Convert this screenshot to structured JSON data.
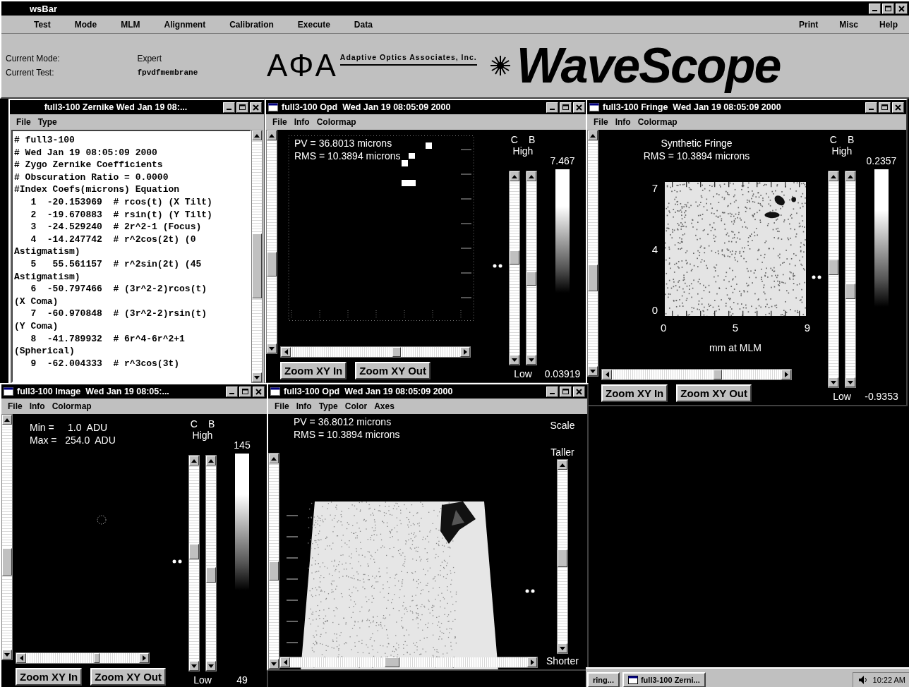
{
  "main_bar": {
    "title": "wsBar",
    "menu": [
      "Test",
      "Mode",
      "MLM",
      "Alignment",
      "Calibration",
      "Execute",
      "Data"
    ],
    "right_menu": [
      "Print",
      "Misc",
      "Help"
    ],
    "current_mode_label": "Current Mode:",
    "current_mode": "Expert",
    "current_test_label": "Current Test:",
    "current_test": "fpvdfmembrane",
    "logo": "AΦA",
    "company": "Adaptive Optics Associates, Inc.",
    "product": "WaveScope"
  },
  "windows": [
    {
      "kind": "text",
      "title": "full3-100 Zernike Wed Jan 19 08:...",
      "menu": [
        "File",
        "Type"
      ],
      "lines": [
        "# full3-100",
        "# Wed Jan 19 08:05:09 2000",
        "# Zygo Zernike Coefficients",
        "# Obscuration Ratio = 0.0000",
        "#Index Coefs(microns) Equation",
        "   1  -20.153969  # rcos(t) (X Tilt)",
        "   2  -19.670883  # rsin(t) (Y Tilt)",
        "   3  -24.529240  # 2r^2-1 (Focus)",
        "   4  -14.247742  # r^2cos(2t) (0",
        "Astigmatism)",
        "   5   55.561157  # r^2sin(2t) (45",
        "Astigmatism)",
        "   6  -50.797466  # (3r^2-2)rcos(t)",
        "(X Coma)",
        "   7  -60.970848  # (3r^2-2)rsin(t)",
        "(Y Coma)",
        "   8  -41.789932  # 6r^4-6r^2+1",
        "(Spherical)",
        "   9  -62.004333  # r^3cos(3t)"
      ]
    },
    {
      "kind": "map",
      "title": "full3-100 Opd  Wed Jan 19 08:05:09 2000",
      "menu": [
        "File",
        "Info",
        "Colormap"
      ],
      "stats": [
        "PV = 36.8013 microns",
        "RMS = 10.3894 microns"
      ],
      "scale": {
        "c": "C",
        "b": "B",
        "high_label": "High",
        "high": "7.467",
        "low_label": "Low",
        "low": "0.03919"
      },
      "buttons": [
        "Zoom XY In",
        "Zoom XY Out"
      ]
    },
    {
      "kind": "fringe",
      "title": "full3-100 Fringe  Wed Jan 19 08:05:09 2000",
      "menu": [
        "File",
        "Info",
        "Colormap"
      ],
      "stats": [
        "Synthetic Fringe",
        "RMS = 10.3894 microns"
      ],
      "y_ticks": [
        "7",
        "4",
        "0"
      ],
      "x_ticks": [
        "0",
        "5",
        "9"
      ],
      "xlabel": "mm at MLM",
      "scale": {
        "c": "C",
        "b": "B",
        "high_label": "High",
        "high": "0.2357",
        "low_label": "Low",
        "low": "-0.9353"
      },
      "buttons": [
        "Zoom XY In",
        "Zoom XY Out"
      ]
    },
    {
      "kind": "image",
      "title": "full3-100 Image  Wed Jan 19 08:05:...",
      "menu": [
        "File",
        "Info",
        "Colormap"
      ],
      "stats": [
        "Min =     1.0  ADU",
        "Max =   254.0  ADU"
      ],
      "scale": {
        "c": "C",
        "b": "B",
        "high_label": "High",
        "high": "145",
        "low_label": "Low",
        "low": "49"
      },
      "buttons": [
        "Zoom XY In",
        "Zoom XY Out"
      ]
    },
    {
      "kind": "surface",
      "title": "full3-100 Opd  Wed Jan 19 08:05:09 2000",
      "menu": [
        "File",
        "Info",
        "Type",
        "Color",
        "Axes"
      ],
      "stats": [
        "PV = 36.8012 microns",
        "RMS = 10.3894 microns"
      ],
      "scale_labels": [
        "Scale",
        "Taller",
        "Shorter"
      ]
    }
  ],
  "taskbar": {
    "buttons": [
      {
        "label": "ring...",
        "selected": false
      },
      {
        "label": "full3-100 Zerni...",
        "selected": false
      }
    ],
    "clock": "10:22 AM"
  }
}
